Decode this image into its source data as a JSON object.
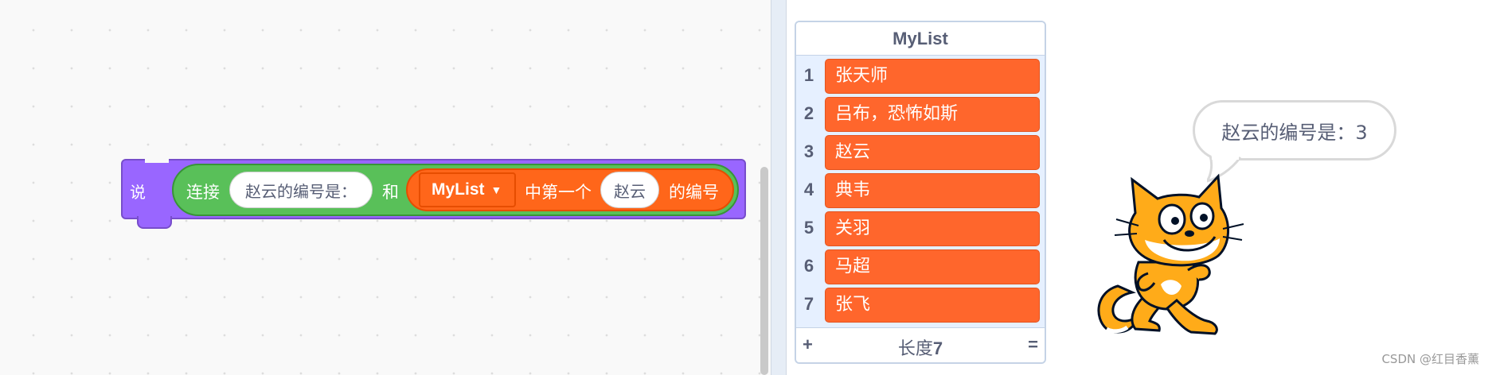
{
  "code_block": {
    "say_label": "说",
    "join_label": "连接",
    "join_input": "赵云的编号是：",
    "and_label": "和",
    "list_name": "MyList",
    "item_of_label": "中第一个",
    "item_input": "赵云",
    "index_label": "的编号"
  },
  "list_monitor": {
    "title": "MyList",
    "items": [
      {
        "index": "1",
        "value": "张天师"
      },
      {
        "index": "2",
        "value": "吕布，恐怖如斯"
      },
      {
        "index": "3",
        "value": "赵云"
      },
      {
        "index": "4",
        "value": "典韦"
      },
      {
        "index": "5",
        "value": "关羽"
      },
      {
        "index": "6",
        "value": "马超"
      },
      {
        "index": "7",
        "value": "张飞"
      }
    ],
    "add_label": "+",
    "length_label": "长度",
    "length_value": "7",
    "resize_label": "="
  },
  "stage": {
    "speech_text": "赵云的编号是：3",
    "sprite_icon": "scratch-cat-icon"
  },
  "watermark": "CSDN @红目香薰",
  "colors": {
    "looks_block": "#9966ff",
    "operators_block": "#59c059",
    "list_block": "#ff661a",
    "list_item": "#ff662c"
  }
}
